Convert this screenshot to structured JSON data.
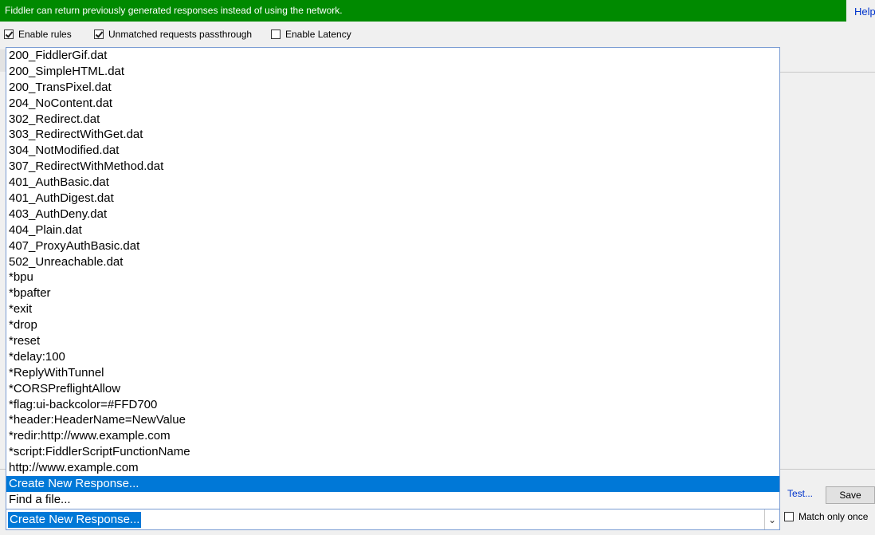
{
  "banner": {
    "message": "Fiddler can return previously generated responses instead of using the network."
  },
  "help_link": "Help",
  "options": [
    {
      "label": "Enable rules",
      "checked": true
    },
    {
      "label": "Unmatched requests passthrough",
      "checked": true
    },
    {
      "label": "Enable Latency",
      "checked": false
    }
  ],
  "response_list": {
    "items": [
      "200_FiddlerGif.dat",
      "200_SimpleHTML.dat",
      "200_TransPixel.dat",
      "204_NoContent.dat",
      "302_Redirect.dat",
      "303_RedirectWithGet.dat",
      "304_NotModified.dat",
      "307_RedirectWithMethod.dat",
      "401_AuthBasic.dat",
      "401_AuthDigest.dat",
      "403_AuthDeny.dat",
      "404_Plain.dat",
      "407_ProxyAuthBasic.dat",
      "502_Unreachable.dat",
      "*bpu",
      "*bpafter",
      "*exit",
      "*drop",
      "*reset",
      "*delay:100",
      "*ReplyWithTunnel",
      "*CORSPreflightAllow",
      "*flag:ui-backcolor=#FFD700",
      "*header:HeaderName=NewValue",
      "*redir:http://www.example.com",
      "*script:FiddlerScriptFunctionName",
      "http://www.example.com",
      "Create New Response...",
      "Find a file..."
    ],
    "selected_index": 27
  },
  "test_link": "Test...",
  "save_label": "Save",
  "combo": {
    "value": "Create New Response..."
  },
  "match_once": {
    "label": "Match only once",
    "checked": false
  },
  "colors": {
    "banner": "#008a00",
    "selection": "#0078d7",
    "link": "#0033cc"
  }
}
